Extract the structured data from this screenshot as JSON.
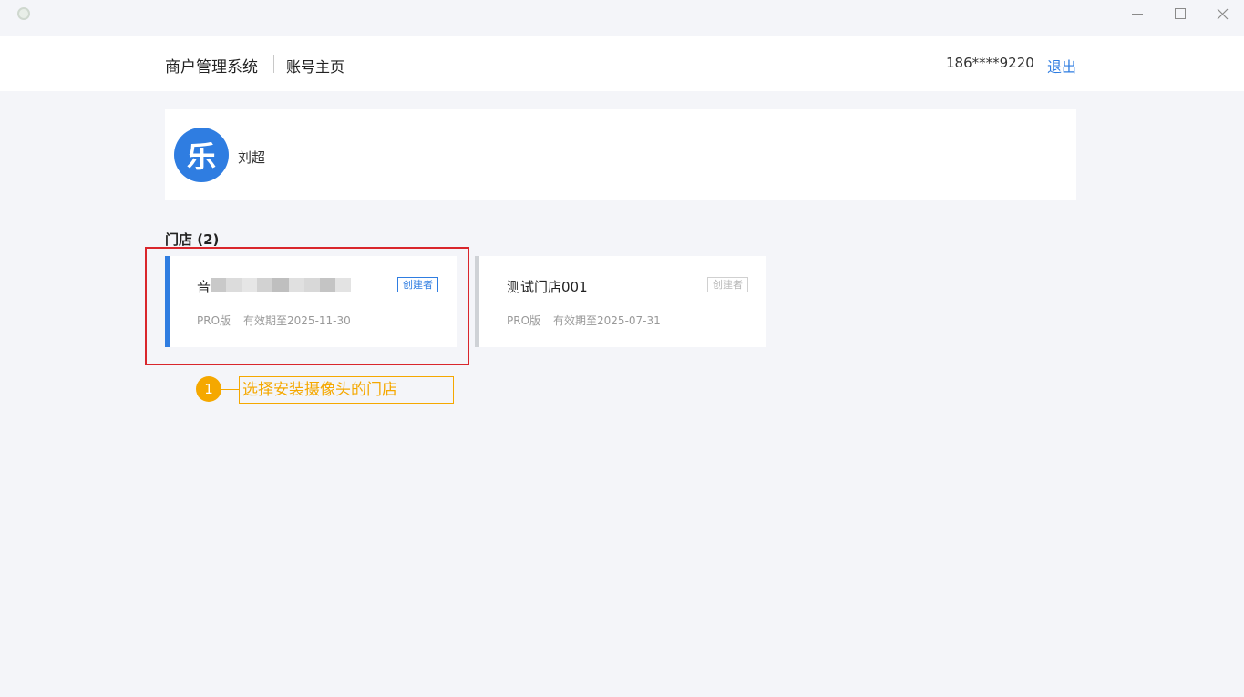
{
  "header": {
    "brand": "商户管理系统",
    "subpage": "账号主页",
    "phone": "186****9220",
    "logout_label": "退出"
  },
  "profile": {
    "avatar_char": "乐",
    "name": "刘超"
  },
  "stores_section": {
    "title": "门店 (2)"
  },
  "stores": [
    {
      "name": "音",
      "badge": "创建者",
      "plan": "PRO版",
      "expire": "有效期至2025-11-30"
    },
    {
      "name": "测试门店001",
      "badge": "创建者",
      "plan": "PRO版",
      "expire": "有效期至2025-07-31"
    }
  ],
  "annotation": {
    "step": "1",
    "text": "选择安装摄像头的门店"
  },
  "colors": {
    "accent": "#2f7de1",
    "highlight": "#d9262c",
    "annotation": "#f5a800"
  }
}
